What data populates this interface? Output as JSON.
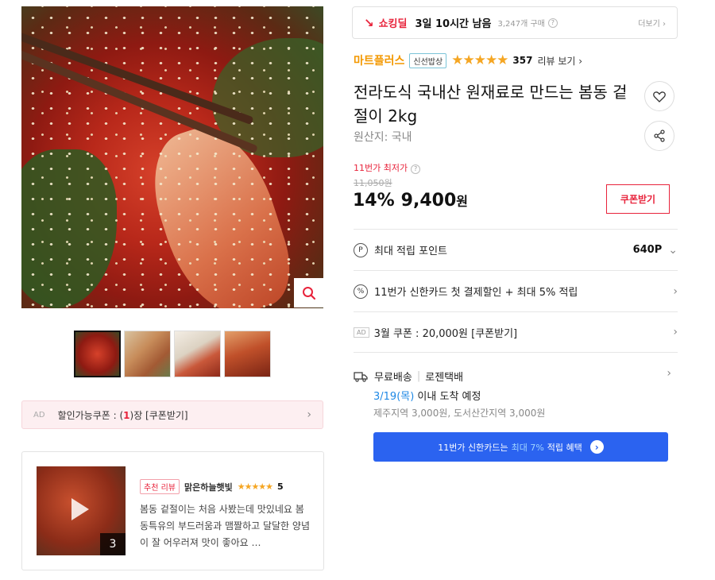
{
  "gallery": {
    "thumbnail_count": 4,
    "active_thumbnail": 1
  },
  "coupon_bar": {
    "ad_label": "AD",
    "text_prefix": "할인가능쿠폰 : (",
    "count": "1",
    "text_suffix": ")장 [쿠폰받기]"
  },
  "review": {
    "badge": "추천 리뷰",
    "reviewer": "맑은하늘햇빛",
    "stars": "★★★★★",
    "score": "5",
    "body": "봄동 겉절이는 처음 사봤는데 맛있네요 봄동특유의 부드러움과 맴짤하고 달달한 양념이 잘 어우러져 맛이 좋아요 …",
    "photo_count": "3"
  },
  "deal": {
    "label": "쇼킹딜",
    "time_left": "3일 10시간 남음",
    "sold": "3,247개 구매",
    "more": "더보기"
  },
  "product": {
    "brand": "마트플러스",
    "brand_badge": "신선밥상",
    "rating_stars": "★★★★★",
    "rating_value": 4.5,
    "review_count": "357",
    "review_link": "리뷰 보기",
    "title": "전라도식 국내산 원재료로 만드는 봄동 겉절이 2kg",
    "origin": "원산지: 국내"
  },
  "pricing": {
    "lowest_label": "11번가 최저가",
    "original_price": "11,050원",
    "discount": "14%",
    "price": "9,400",
    "currency": "원",
    "coupon_button": "쿠폰받기"
  },
  "benefits": {
    "points_icon": "P",
    "points_label": "최대 적립 포인트",
    "points_value": "640P",
    "card_icon": "%",
    "card_text": "11번가 신한카드 첫 결제할인 + 최대 5% 적립",
    "ad_label": "AD",
    "coupon_text": "3월 쿠폰 : 20,000원 [쿠폰받기]"
  },
  "shipping": {
    "free": "무료배송",
    "carrier": "로젠택배",
    "date": "3/19(목)",
    "date_suffix": " 이내 도착 예정",
    "extra": "제주지역 3,000원, 도서산간지역 3,000원"
  },
  "promo": {
    "prefix": "11번가 신한카드는",
    "highlight": "최대 7%",
    "suffix": "적립 혜택"
  },
  "colors": {
    "accent_red": "#e8233b",
    "brand_orange": "#f39800",
    "promo_blue": "#2b63f0",
    "star_gold": "#f5a623",
    "ship_blue": "#1e88e5"
  }
}
